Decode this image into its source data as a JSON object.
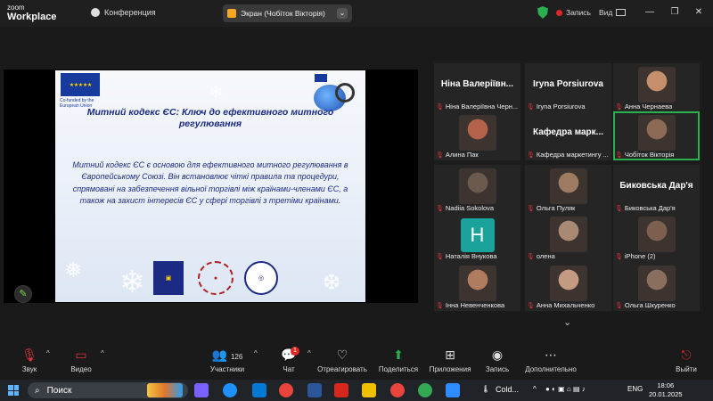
{
  "app": {
    "brand_line1": "zoom",
    "brand_line2": "Workplace",
    "conference_label": "Конференция"
  },
  "screen_share": {
    "label": "Экран (Чобіток Вікторія)"
  },
  "top_right": {
    "record_label": "Запись",
    "view_label": "Вид"
  },
  "slide": {
    "cofunded": "Co-funded by the European Union",
    "title": "Митний кодекс ЄС: Ключ до ефективного митного регулювання",
    "body": "Митний кодекс ЄС є основою для ефективного митного регулювання в Європейському Союзі. Він встановлює чіткі правила та процедури, спрямовані на забезпечення вільної торгівлі між країнами-членами ЄС, а також на захист інтересів ЄС у сфері торгівлі з третіми країнами."
  },
  "participants": [
    {
      "display": "Ніна Валеріївн...",
      "label": "Ніна Валеріївна Черн...",
      "video": false
    },
    {
      "display": "Iryna Porsiurova",
      "label": "Iryna Porsiurova",
      "video": false
    },
    {
      "display": "",
      "label": "Анна Чернаева",
      "video": true
    },
    {
      "display": "",
      "label": "Алина Пак",
      "video": true
    },
    {
      "display": "Кафедра марк...",
      "label": "Кафедра маркетингу ...",
      "video": false
    },
    {
      "display": "",
      "label": "Чобіток Вікторія",
      "video": true,
      "speaking": true
    },
    {
      "display": "",
      "label": "Nadiia Sokolova",
      "video": true
    },
    {
      "display": "",
      "label": "Ольга Пуляк",
      "video": true
    },
    {
      "display": "Биковська Дар'я",
      "label": "Биковська Дар'я",
      "video": false
    },
    {
      "display": "H",
      "label": "Наталія Внукова",
      "video": false,
      "avatar": true
    },
    {
      "display": "",
      "label": "олена",
      "video": true
    },
    {
      "display": "",
      "label": "iPhone (2)",
      "video": true
    },
    {
      "display": "",
      "label": "Інна Невенченкова",
      "video": true
    },
    {
      "display": "",
      "label": "Анна Михальченко",
      "video": true
    },
    {
      "display": "",
      "label": "Ольга Шкуренко",
      "video": true
    }
  ],
  "toolbar": {
    "audio": "Звук",
    "video": "Видео",
    "participants": "Участники",
    "participants_count": "126",
    "chat": "Чат",
    "chat_badge": "1",
    "react": "Отреагировать",
    "share": "Поделиться",
    "apps": "Приложения",
    "record": "Запись",
    "more": "Дополнительно",
    "leave": "Выйти"
  },
  "taskbar": {
    "search_placeholder": "Поиск",
    "weather": "Cold...",
    "lang": "ENG",
    "time": "18:06",
    "date": "20.01.2025"
  },
  "colors": {
    "accent_green": "#2ab04f",
    "record_red": "#e02828",
    "slide_text": "#1b2b84",
    "avatar_teal": "#1aa39a"
  }
}
